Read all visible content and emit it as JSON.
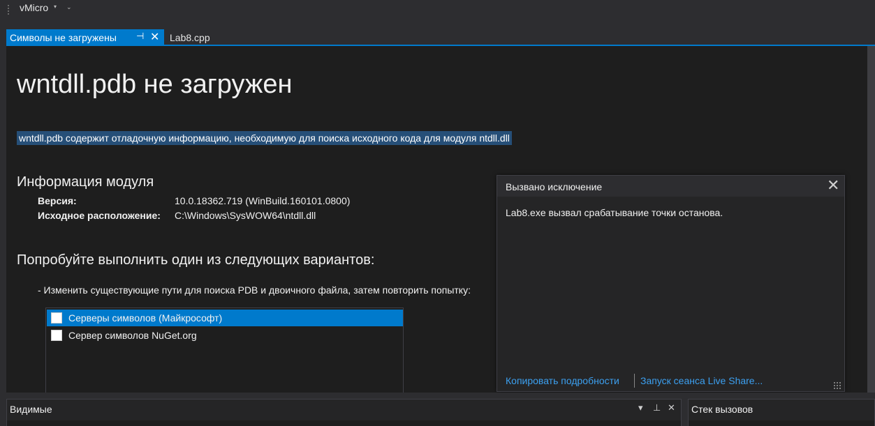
{
  "toolbar": {
    "vmicro_label": "vMicro",
    "vmicro_caret": "▾",
    "overflow_glyph": "⌄"
  },
  "tabs": [
    {
      "label": "Символы не загружены",
      "active": true,
      "pin": "⊣",
      "close": "✕"
    },
    {
      "label": "Lab8.cpp",
      "active": false
    }
  ],
  "document": {
    "title": "wntdll.pdb не загружен",
    "description": "wntdll.pdb содержит отладочную информацию, необходимую для поиска исходного кода для модуля ntdll.dll",
    "module_info_heading": "Информация модуля",
    "version_label": "Версия:",
    "version_value": "10.0.18362.719 (WinBuild.160101.0800)",
    "location_label": "Исходное расположение:",
    "location_value": "C:\\Windows\\SysWOW64\\ntdll.dll",
    "options_heading": "Попробуйте выполнить один из следующих вариантов:",
    "option_1": "-  Изменить существующие пути для поиска PDB и двоичного файла, затем повторить попытку:",
    "symbol_servers": [
      {
        "label": "Серверы символов (Майкрософт)",
        "checked": false,
        "selected": true
      },
      {
        "label": "Сервер символов NuGet.org",
        "checked": false,
        "selected": false
      }
    ]
  },
  "exception_popup": {
    "title": "Вызвано исключение",
    "close_glyph": "✕",
    "message": "Lab8.exe вызвал срабатывание точки останова.",
    "copy_details_link": "Копировать подробности",
    "live_share_link": "Запуск сеанса Live Share..."
  },
  "bottom_panels": {
    "watch": {
      "title": "Видимые",
      "dropdown_glyph": "▾",
      "pin_glyph": "⊥",
      "close_glyph": "✕"
    },
    "call_stack": {
      "title": "Стек вызовов"
    }
  },
  "colors": {
    "accent": "#007acc",
    "link": "#3ca0f0",
    "editor_bg": "#1e1e1e",
    "chrome_bg": "#2d2d30",
    "selection": "#264f78"
  }
}
